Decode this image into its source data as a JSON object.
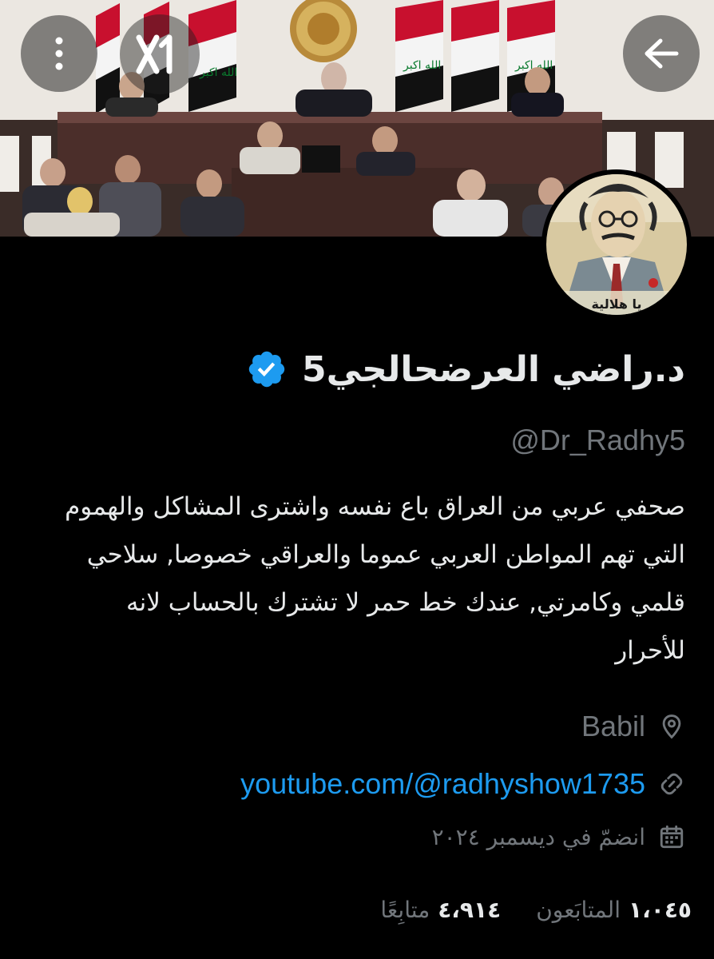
{
  "header": {
    "more_icon": "more-vertical-icon",
    "back_icon": "arrow-left-icon",
    "watermark_text": "X1"
  },
  "banner": {
    "description_icon": "parliament-photo",
    "flag_text": "الله اكبر"
  },
  "avatar": {
    "caption": "يا هلالية"
  },
  "profile": {
    "display_name": "د.راضي العرضحالجي5",
    "verified_icon": "verified-badge-icon",
    "verified_color": "#1d9bf0",
    "handle": "@Dr_Radhy5",
    "bio": "صحفي عربي من العراق باع نفسه واشترى المشاكل والهموم التي تهم المواطن العربي عموما والعراقي خصوصا, سلاحي قلمي وكامرتي, عندك خط حمر لا تشترك بالحساب لانه للأحرار",
    "location": "Babil",
    "location_icon": "location-pin-icon",
    "link": "youtube.com/@radhyshow1735",
    "link_icon": "link-icon",
    "joined": "انضمّ في ديسمبر ٢٠٢٤",
    "joined_icon": "calendar-icon",
    "link_color": "#1d9bf0"
  },
  "stats": {
    "followers_count": "١،٠٤٥",
    "followers_label": "المتابَعون",
    "following_count": "٤،٩١٤",
    "following_label": "متابِعًا"
  }
}
